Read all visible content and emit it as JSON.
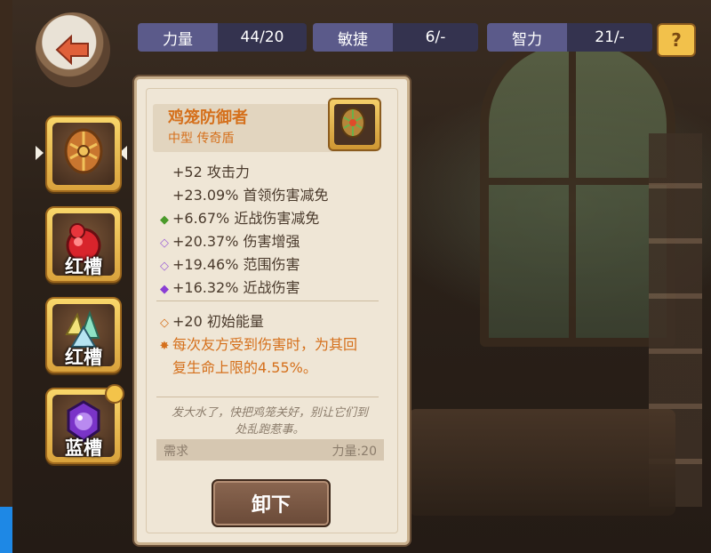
{
  "nav": {
    "back_icon": "back-arrow-icon"
  },
  "stats": [
    {
      "label": "力量",
      "value": "44/20"
    },
    {
      "label": "敏捷",
      "value": "6/-"
    },
    {
      "label": "智力",
      "value": "21/-"
    }
  ],
  "help": {
    "icon": "help-book-icon",
    "label": "?"
  },
  "slots": [
    {
      "name": "shield-slot",
      "label": "",
      "selected": true,
      "icon": "shield-icon"
    },
    {
      "name": "red-slot-1",
      "label": "红槽",
      "icon": "red-potion-icon"
    },
    {
      "name": "red-slot-2",
      "label": "红槽",
      "icon": "crystal-cluster-icon"
    },
    {
      "name": "blue-slot",
      "label": "蓝槽",
      "icon": "purple-gem-icon",
      "badge": "wrench-icon"
    }
  ],
  "item": {
    "name": "鸡笼防御者",
    "type": "中型 传奇盾",
    "base_stats": [
      "+52 攻击力",
      "+23.09% 首领伤害减免"
    ],
    "affixes": [
      {
        "marker": "green-diamond",
        "text": "+6.67% 近战伤害减免"
      },
      {
        "marker": "purple-diamond-outline",
        "text": "+20.37% 伤害增强"
      },
      {
        "marker": "purple-diamond-outline",
        "text": "+19.46% 范围伤害"
      },
      {
        "marker": "purple-diamond",
        "text": "+16.32% 近战伤害"
      }
    ],
    "special": [
      {
        "marker": "orange-diamond-outline",
        "text": "+20 初始能量"
      },
      {
        "marker": "orange-star",
        "text": "每次友方受到伤害时，为其回",
        "text2": "复生命上限的4.55%。"
      }
    ],
    "flavor_line1": "发大水了，快把鸡笼关好，别让它们到",
    "flavor_line2": "处乱跑惹事。",
    "requirement_label": "需求",
    "requirement_value": "力量:20"
  },
  "actions": {
    "unequip_label": "卸下"
  }
}
